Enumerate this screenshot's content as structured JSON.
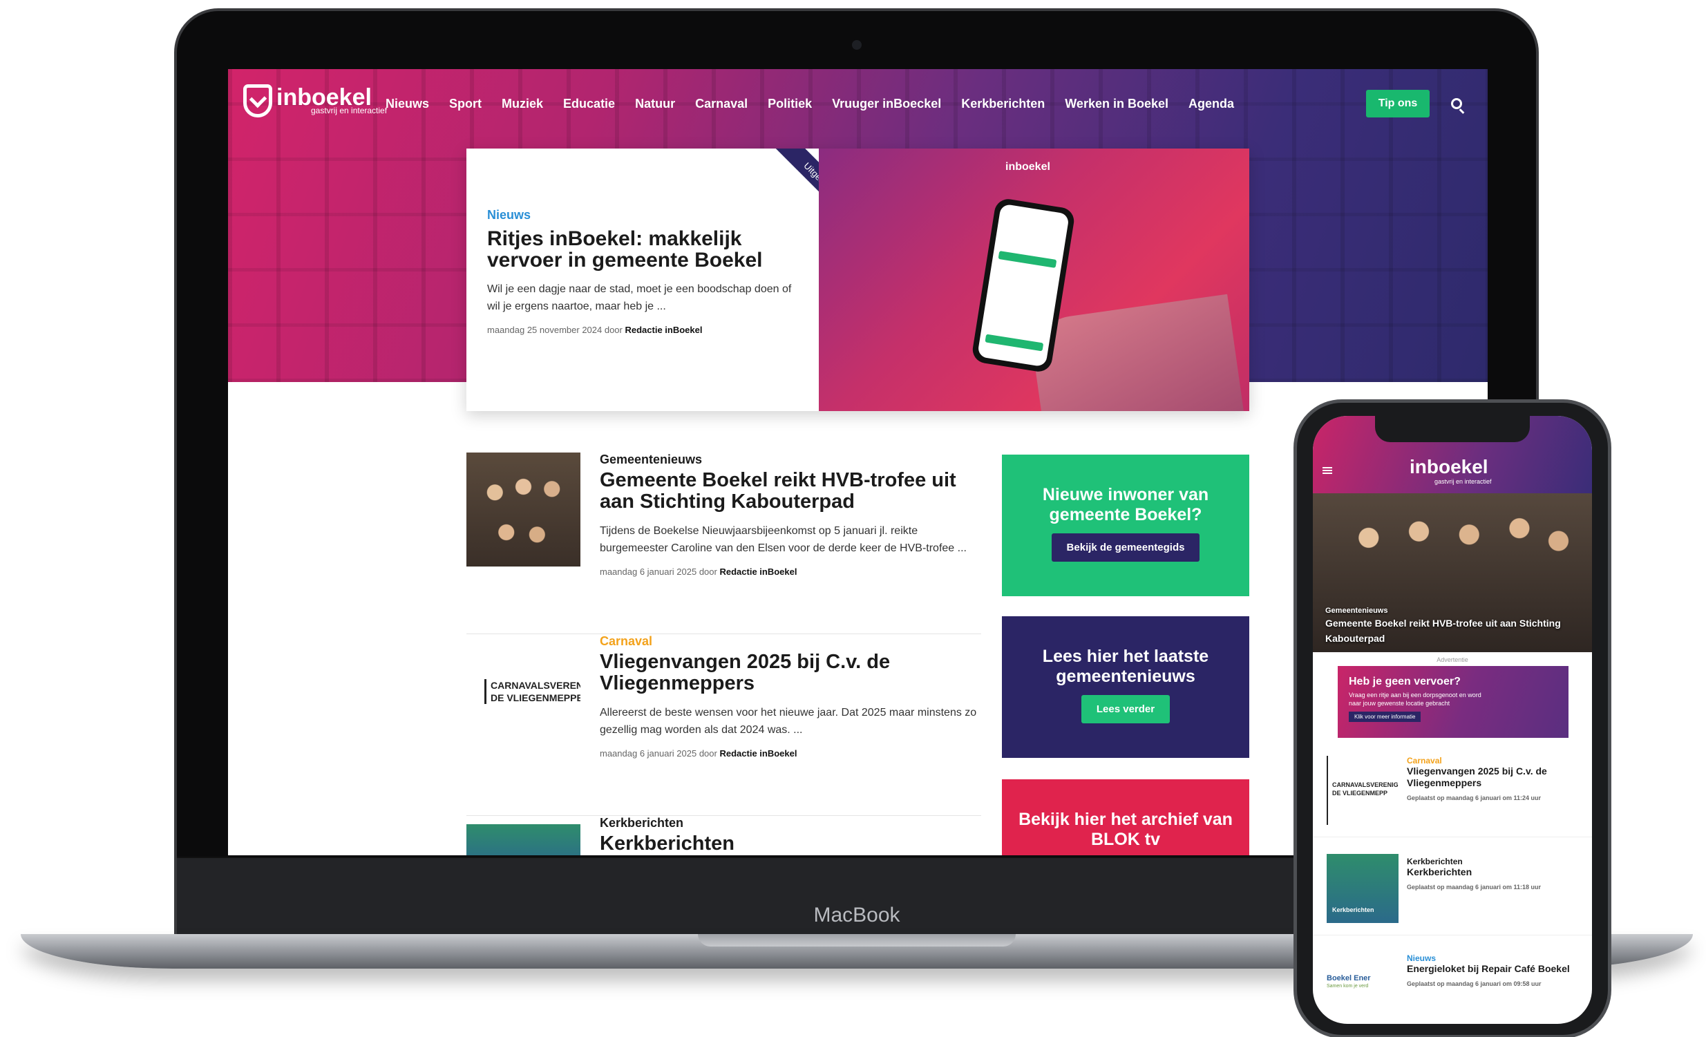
{
  "laptop": {
    "brand_label": "MacBook",
    "site": {
      "logo_text": "inboekel",
      "logo_tagline": "gastvrij en interactief",
      "nav": [
        "Nieuws",
        "Sport",
        "Muziek",
        "Educatie",
        "Natuur",
        "Carnaval",
        "Politiek",
        "Vruuger inBoeckel",
        "Kerkberichten",
        "Werken in Boekel",
        "Agenda"
      ],
      "tip_button": "Tip ons",
      "featured": {
        "ribbon": "Uitgelicht",
        "category": "Nieuws",
        "title": "Ritjes inBoekel: makkelijk vervoer in gemeente Boekel",
        "excerpt": "Wil je een dagje naar de stad, moet je een boodschap doen of wil je ergens naartoe, maar heb je ...",
        "date": "maandag 25 november 2024 door",
        "author": "Redactie inBoekel",
        "image_logo": "inboekel"
      },
      "articles": [
        {
          "category": "Gemeentenieuws",
          "title": "Gemeente Boekel reikt HVB-trofee uit aan Stichting Kabouterpad",
          "excerpt": "Tijdens de Boekelse Nieuwjaarsbijeenkomst op 5 januari jl. reikte burgemeester Caroline van den Elsen voor de derde keer de HVB-trofee ...",
          "date": "maandag 6 januari 2025  door",
          "author": "Redactie inBoekel"
        },
        {
          "category": "Carnaval",
          "title": "Vliegenvangen 2025 bij C.v. de Vliegenmeppers",
          "excerpt": "Allereerst de beste wensen voor het nieuwe jaar. Dat 2025 maar minstens zo gezellig mag worden als dat 2024 was. ...",
          "date": "maandag 6 januari 2025  door",
          "author": "Redactie inBoekel",
          "thumb_text": [
            "CARNAVALSVERENIG",
            "DE VLIEGENMEPPE"
          ]
        },
        {
          "category": "Kerkberichten",
          "title": "Kerkberichten"
        }
      ],
      "promos": [
        {
          "title": "Nieuwe inwoner van gemeente Boekel?",
          "button": "Bekijk de gemeentegids"
        },
        {
          "title": "Lees hier het laatste gemeentenieuws",
          "button": "Lees verder"
        },
        {
          "title": "Bekijk hier het archief van BLOK tv"
        }
      ]
    }
  },
  "phone": {
    "logo_text": "inboekel",
    "logo_tagline": "gastvrij en interactief",
    "hero_category": "Gemeentenieuws",
    "hero_title": "Gemeente Boekel reikt HVB-trofee uit aan Stichting Kabouterpad",
    "ad_label": "Advertentie",
    "ad": {
      "title": "Heb je geen vervoer?",
      "text": "Vraag een ritje aan bij een dorpsgenoot en word naar jouw gewenste locatie gebracht",
      "button": "Klik voor meer informatie"
    },
    "items": [
      {
        "category": "Carnaval",
        "title": "Vliegenvangen 2025 bij C.v. de Vliegenmeppers",
        "meta": "Geplaatst op maandag 6 januari om 11:24 uur",
        "thumb_text": [
          "CARNAVALSVERENIG",
          "DE VLIEGENMEPP"
        ]
      },
      {
        "category": "Kerkberichten",
        "title": "Kerkberichten",
        "meta": "Geplaatst op maandag 6 januari om 11:18 uur",
        "thumb_text": [
          "Kerkberichten"
        ]
      },
      {
        "category": "Nieuws",
        "title": "Energieloket bij Repair Café Boekel",
        "meta": "Geplaatst op maandag 6 januari om 09:58 uur",
        "thumb_text": [
          "Boekel Ener",
          "Samen kom je verd"
        ]
      }
    ]
  },
  "colors": {
    "brand_pink": "#d2246a",
    "navy": "#2b2565",
    "green": "#1fc178",
    "red": "#e0234d",
    "link_blue": "#2a8fd6",
    "carnaval_orange": "#f3a21b"
  }
}
